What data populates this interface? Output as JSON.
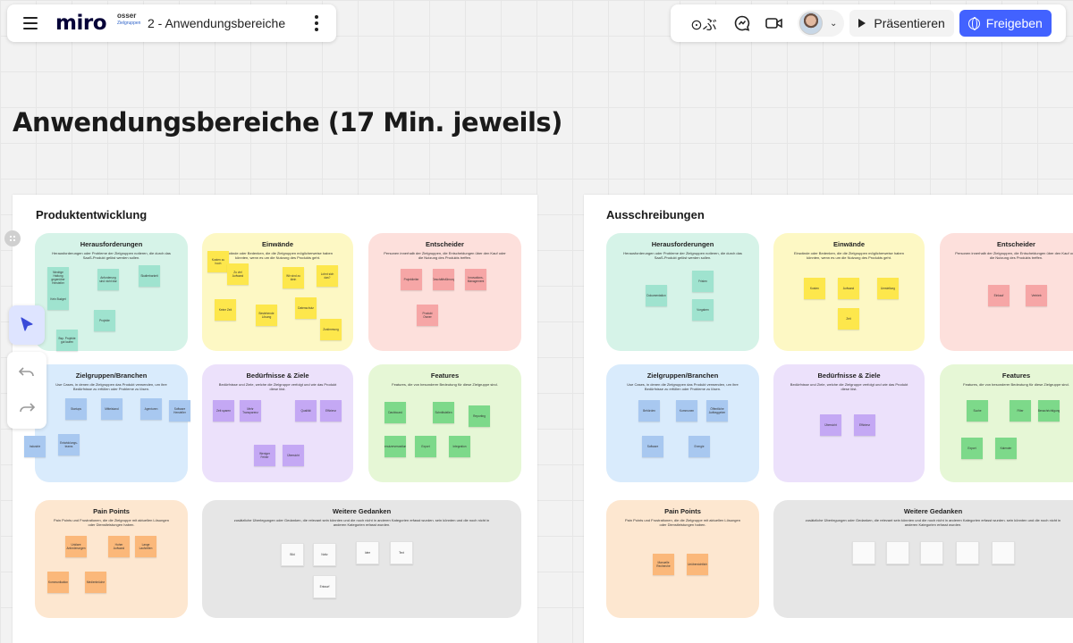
{
  "app": {
    "logo": "miro",
    "board_title": "2 - Anwendungsbereiche",
    "board_thumb_line1": "osser",
    "board_thumb_line2": "Zielgruppen"
  },
  "toolbar": {
    "reactions_label": "⊙ぶ",
    "present_label": "Präsentieren",
    "share_label": "Freigeben",
    "accent_color": "#4262ff"
  },
  "page": {
    "heading": "Anwendungsbereiche (17 Min. jeweils)"
  },
  "frames": [
    {
      "title": "Produktentwicklung",
      "sections": {
        "herausforderungen": {
          "title": "Herausforderungen",
          "desc": "Herausforderungen oder Probleme der Zielgruppen notieren, die durch das SaaS-Produkt gelöst werden sollen."
        },
        "einwaende": {
          "title": "Einwände",
          "desc": "Einwände oder Bedenken, die die Zielgruppen möglicherweise haben könnten, wenn es um die Nutzung des Produkts geht."
        },
        "entscheider": {
          "title": "Entscheider",
          "desc": "Personen innerhalb der Zielgruppen, die Entscheidungen über den Kauf oder die Nutzung des Produkts treffen."
        },
        "zielgruppen": {
          "title": "Zielgruppen/Branchen",
          "desc": "Use Cases, in denen die Zielgruppen das Produkt verwenden, um ihre Bedürfnisse zu erfüllen oder Probleme zu lösen."
        },
        "beduerfnisse": {
          "title": "Bedürfnisse & Ziele",
          "desc": "Bedürfnisse und Ziele, welche die Zielgruppe verfolgt und wie das Produkt diese löst."
        },
        "features": {
          "title": "Features",
          "desc": "Features, die von besonderer Bedeutung für diese Zielgruppe sind."
        },
        "painpoints": {
          "title": "Pain Points",
          "desc": "Pain Points und Frustrationen, die die Zielgruppe mit aktuellen Lösungen oder Dienstleistungen haben."
        },
        "gedanken": {
          "title": "Weitere Gedanken",
          "desc": "zusätzliche Überlegungen oder Gedanken, die relevant sein könnten und die noch nicht in anderen Kategorien erfasst wurden. sein könnten und die noch nicht in anderen Kategorien erfasst wurden."
        }
      }
    },
    {
      "title": "Ausschreibungen",
      "sections": {
        "herausforderungen": {
          "title": "Herausforderungen",
          "desc": "Herausforderungen oder Probleme der Zielgruppen notieren, die durch das SaaS-Produkt gelöst werden sollen."
        },
        "einwaende": {
          "title": "Einwände",
          "desc": "Einwände oder Bedenken, die die Zielgruppen möglicherweise haben könnten, wenn es um die Nutzung des Produkts geht."
        },
        "entscheider": {
          "title": "Entscheider",
          "desc": "Personen innerhalb der Zielgruppen, die Entscheidungen über den Kauf oder die Nutzung des Produkts treffen."
        },
        "zielgruppen": {
          "title": "Zielgruppen/Branchen",
          "desc": "Use Cases, in denen die Zielgruppen das Produkt verwenden, um ihre Bedürfnisse zu erfüllen oder Probleme zu lösen."
        },
        "beduerfnisse": {
          "title": "Bedürfnisse & Ziele",
          "desc": "Bedürfnisse und Ziele, welche die Zielgruppe verfolgt und wie das Produkt diese löst."
        },
        "features": {
          "title": "Features",
          "desc": "Features, die von besonderer Bedeutung für diese Zielgruppe sind."
        },
        "painpoints": {
          "title": "Pain Points",
          "desc": "Pain Points und Frustrationen, die die Zielgruppe mit aktuellen Lösungen oder Dienstleistungen haben."
        },
        "gedanken": {
          "title": "Weitere Gedanken",
          "desc": "zusätzliche Überlegungen oder Gedanken, die relevant sein könnten und die noch nicht in anderen Kategorien erfasst wurden. sein könnten und die noch nicht in anderen Kategorien erfasst wurden."
        }
      }
    }
  ],
  "sticky_notes": [
    {
      "frame": 0,
      "section": "herausforderungen",
      "color": "teal",
      "text": "Niedrige Haltung gegenüber Hersteller"
    },
    {
      "frame": 0,
      "section": "herausforderungen",
      "color": "teal",
      "text": "Anforderung sind nicht klar"
    },
    {
      "frame": 0,
      "section": "herausforderungen",
      "color": "teal",
      "text": "Skalierbarkeit"
    },
    {
      "frame": 0,
      "section": "herausforderungen",
      "color": "teal",
      "text": "Kein Budget"
    },
    {
      "frame": 0,
      "section": "herausforderungen",
      "color": "teal",
      "text": "Projekte"
    },
    {
      "frame": 0,
      "section": "herausforderungen",
      "color": "teal",
      "text": "Bsp. Projekte gut laufen"
    },
    {
      "frame": 0,
      "section": "einwaende",
      "color": "yellow",
      "text": "Kosten zu hoch"
    },
    {
      "frame": 0,
      "section": "einwaende",
      "color": "yellow",
      "text": "Zu viel Aufwand"
    },
    {
      "frame": 0,
      "section": "einwaende",
      "color": "yellow",
      "text": "Wir sind zu klein"
    },
    {
      "frame": 0,
      "section": "einwaende",
      "color": "yellow",
      "text": "Lohnt sich das?"
    },
    {
      "frame": 0,
      "section": "einwaende",
      "color": "yellow",
      "text": "Keine Zeit"
    },
    {
      "frame": 0,
      "section": "einwaende",
      "color": "yellow",
      "text": "Bestehende Lösung"
    },
    {
      "frame": 0,
      "section": "einwaende",
      "color": "yellow",
      "text": "Datenschutz"
    },
    {
      "frame": 0,
      "section": "einwaende",
      "color": "yellow",
      "text": "Zustimmung"
    },
    {
      "frame": 0,
      "section": "entscheider",
      "color": "red",
      "text": "Projektleiter"
    },
    {
      "frame": 0,
      "section": "entscheider",
      "color": "red",
      "text": "Geschäftsführung"
    },
    {
      "frame": 0,
      "section": "entscheider",
      "color": "red",
      "text": "Innovations-Management"
    },
    {
      "frame": 0,
      "section": "entscheider",
      "color": "red",
      "text": "Produkt Owner"
    },
    {
      "frame": 0,
      "section": "zielgruppen",
      "color": "blue",
      "text": "Startups"
    },
    {
      "frame": 0,
      "section": "zielgruppen",
      "color": "blue",
      "text": "Mittelstand"
    },
    {
      "frame": 0,
      "section": "zielgruppen",
      "color": "blue",
      "text": "Agenturen"
    },
    {
      "frame": 0,
      "section": "zielgruppen",
      "color": "blue",
      "text": "Software Hersteller"
    },
    {
      "frame": 0,
      "section": "zielgruppen",
      "color": "blue",
      "text": "Industrie"
    },
    {
      "frame": 0,
      "section": "zielgruppen",
      "color": "blue",
      "text": "Entwicklungs-teams"
    },
    {
      "frame": 0,
      "section": "beduerfnisse",
      "color": "purple",
      "text": "Zeit sparen"
    },
    {
      "frame": 0,
      "section": "beduerfnisse",
      "color": "purple",
      "text": "Mehr Transparenz"
    },
    {
      "frame": 0,
      "section": "beduerfnisse",
      "color": "purple",
      "text": "Qualität"
    },
    {
      "frame": 0,
      "section": "beduerfnisse",
      "color": "purple",
      "text": "Effizienz"
    },
    {
      "frame": 0,
      "section": "beduerfnisse",
      "color": "purple",
      "text": "Weniger Fehler"
    },
    {
      "frame": 0,
      "section": "beduerfnisse",
      "color": "purple",
      "text": "Übersicht"
    },
    {
      "frame": 0,
      "section": "features",
      "color": "green",
      "text": "Dashboard"
    },
    {
      "frame": 0,
      "section": "features",
      "color": "green",
      "text": "Schnittstellen"
    },
    {
      "frame": 0,
      "section": "features",
      "color": "green",
      "text": "Reporting"
    },
    {
      "frame": 0,
      "section": "features",
      "color": "green",
      "text": "Benutzerverwaltung"
    },
    {
      "frame": 0,
      "section": "features",
      "color": "green",
      "text": "Export"
    },
    {
      "frame": 0,
      "section": "features",
      "color": "green",
      "text": "Integration"
    },
    {
      "frame": 0,
      "section": "painpoints",
      "color": "orange",
      "text": "Unklare Anforderungen"
    },
    {
      "frame": 0,
      "section": "painpoints",
      "color": "orange",
      "text": "Hoher Aufwand"
    },
    {
      "frame": 0,
      "section": "painpoints",
      "color": "orange",
      "text": "Lange Laufzeiten"
    },
    {
      "frame": 0,
      "section": "painpoints",
      "color": "orange",
      "text": "Kommunikation"
    },
    {
      "frame": 0,
      "section": "painpoints",
      "color": "orange",
      "text": "Medienbrüche"
    },
    {
      "frame": 0,
      "section": "gedanken",
      "color": "white",
      "text": "Bild"
    },
    {
      "frame": 0,
      "section": "gedanken",
      "color": "white",
      "text": "Notiz"
    },
    {
      "frame": 0,
      "section": "gedanken",
      "color": "white",
      "text": "Idee"
    },
    {
      "frame": 0,
      "section": "gedanken",
      "color": "white",
      "text": "Text"
    },
    {
      "frame": 0,
      "section": "gedanken",
      "color": "white",
      "text": "Entwurf"
    },
    {
      "frame": 1,
      "section": "herausforderungen",
      "color": "teal",
      "text": "Dokumentation"
    },
    {
      "frame": 1,
      "section": "herausforderungen",
      "color": "teal",
      "text": "Fristen"
    },
    {
      "frame": 1,
      "section": "herausforderungen",
      "color": "teal",
      "text": "Vorgaben"
    },
    {
      "frame": 1,
      "section": "einwaende",
      "color": "yellow",
      "text": "Kosten"
    },
    {
      "frame": 1,
      "section": "einwaende",
      "color": "yellow",
      "text": "Aufwand"
    },
    {
      "frame": 1,
      "section": "einwaende",
      "color": "yellow",
      "text": "Umstellung"
    },
    {
      "frame": 1,
      "section": "einwaende",
      "color": "yellow",
      "text": "Zeit"
    },
    {
      "frame": 1,
      "section": "entscheider",
      "color": "red",
      "text": "Einkauf"
    },
    {
      "frame": 1,
      "section": "entscheider",
      "color": "red",
      "text": "Vertrieb"
    },
    {
      "frame": 1,
      "section": "zielgruppen",
      "color": "blue",
      "text": "Behörden"
    },
    {
      "frame": 1,
      "section": "zielgruppen",
      "color": "blue",
      "text": "Kommunen"
    },
    {
      "frame": 1,
      "section": "zielgruppen",
      "color": "blue",
      "text": "Öffentliche Auftraggeber"
    },
    {
      "frame": 1,
      "section": "zielgruppen",
      "color": "blue",
      "text": "Software"
    },
    {
      "frame": 1,
      "section": "zielgruppen",
      "color": "blue",
      "text": "Energie"
    },
    {
      "frame": 1,
      "section": "beduerfnisse",
      "color": "purple",
      "text": "Übersicht"
    },
    {
      "frame": 1,
      "section": "beduerfnisse",
      "color": "purple",
      "text": "Effizienz"
    },
    {
      "frame": 1,
      "section": "features",
      "color": "green",
      "text": "Suche"
    },
    {
      "frame": 1,
      "section": "features",
      "color": "green",
      "text": "Filter"
    },
    {
      "frame": 1,
      "section": "features",
      "color": "green",
      "text": "Benachrichtigung"
    },
    {
      "frame": 1,
      "section": "features",
      "color": "green",
      "text": "Export"
    },
    {
      "frame": 1,
      "section": "features",
      "color": "green",
      "text": "Kalender"
    },
    {
      "frame": 1,
      "section": "painpoints",
      "color": "orange",
      "text": "Manuelle Recherche"
    },
    {
      "frame": 1,
      "section": "painpoints",
      "color": "orange",
      "text": "Unübersichtlich"
    },
    {
      "frame": 1,
      "section": "gedanken",
      "color": "white",
      "text": ""
    },
    {
      "frame": 1,
      "section": "gedanken",
      "color": "white",
      "text": ""
    },
    {
      "frame": 1,
      "section": "gedanken",
      "color": "white",
      "text": ""
    },
    {
      "frame": 1,
      "section": "gedanken",
      "color": "white",
      "text": ""
    },
    {
      "frame": 1,
      "section": "gedanken",
      "color": "white",
      "text": ""
    }
  ]
}
